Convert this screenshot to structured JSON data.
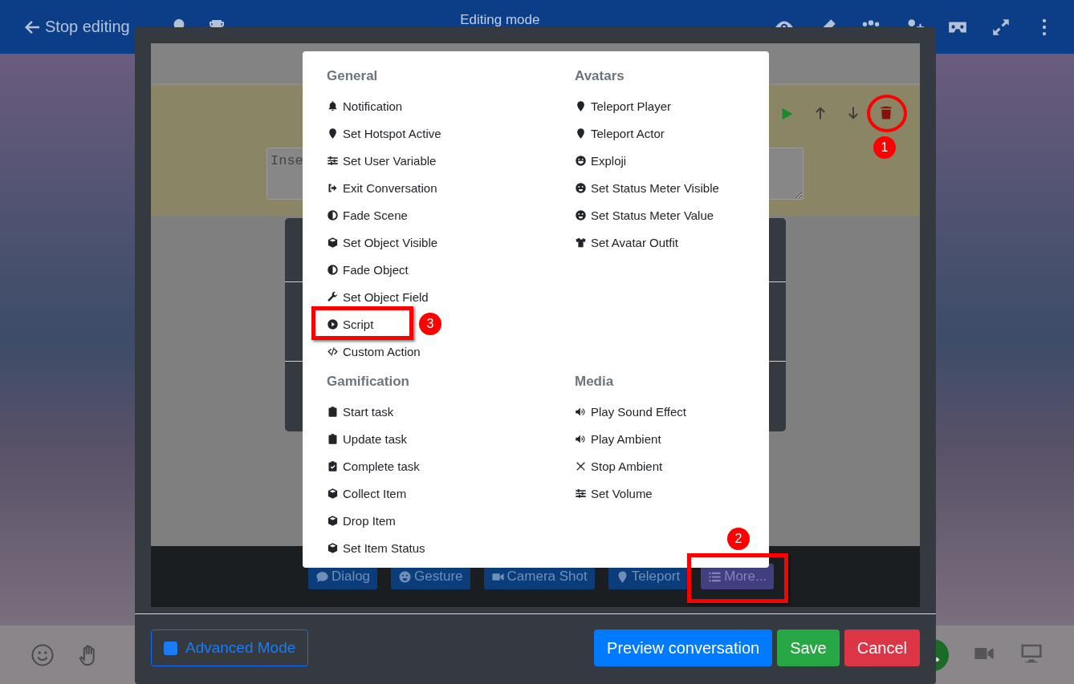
{
  "top_bar": {
    "back_label": "Stop editing",
    "title": "Editing mode"
  },
  "editor": {
    "textarea": {
      "placeholder": "Inse"
    },
    "add_buttons": [
      {
        "label": "Dialog",
        "selected": false
      },
      {
        "label": "Gesture",
        "selected": false
      },
      {
        "label": "Camera Shot",
        "selected": false
      },
      {
        "label": "Teleport",
        "selected": false
      },
      {
        "label": "More...",
        "selected": true
      }
    ]
  },
  "action_menu": {
    "sections": [
      {
        "heading": "General",
        "items": [
          "Notification",
          "Set Hotspot Active",
          "Set User Variable",
          "Exit Conversation",
          "Fade Scene",
          "Set Object Visible",
          "Fade Object",
          "Set Object Field",
          "Script",
          "Custom Action"
        ]
      },
      {
        "heading": "Avatars",
        "items": [
          "Teleport Player",
          "Teleport Actor",
          "Exploji",
          "Set Status Meter Visible",
          "Set Status Meter Value",
          "Set Avatar Outfit"
        ]
      },
      {
        "heading": "Gamification",
        "items": [
          "Start task",
          "Update task",
          "Complete task",
          "Collect Item",
          "Drop Item",
          "Set Item Status"
        ]
      },
      {
        "heading": "Media",
        "items": [
          "Play Sound Effect",
          "Play Ambient",
          "Stop Ambient",
          "Set Volume"
        ]
      }
    ]
  },
  "footer": {
    "advanced_mode": {
      "label": "Advanced Mode",
      "checked": true
    },
    "buttons": [
      {
        "label": "Preview conversation",
        "kind": "primary"
      },
      {
        "label": "Save",
        "kind": "success"
      },
      {
        "label": "Cancel",
        "kind": "danger"
      }
    ]
  },
  "annotations": [
    {
      "label": "1"
    },
    {
      "label": "2"
    },
    {
      "label": "3"
    }
  ]
}
